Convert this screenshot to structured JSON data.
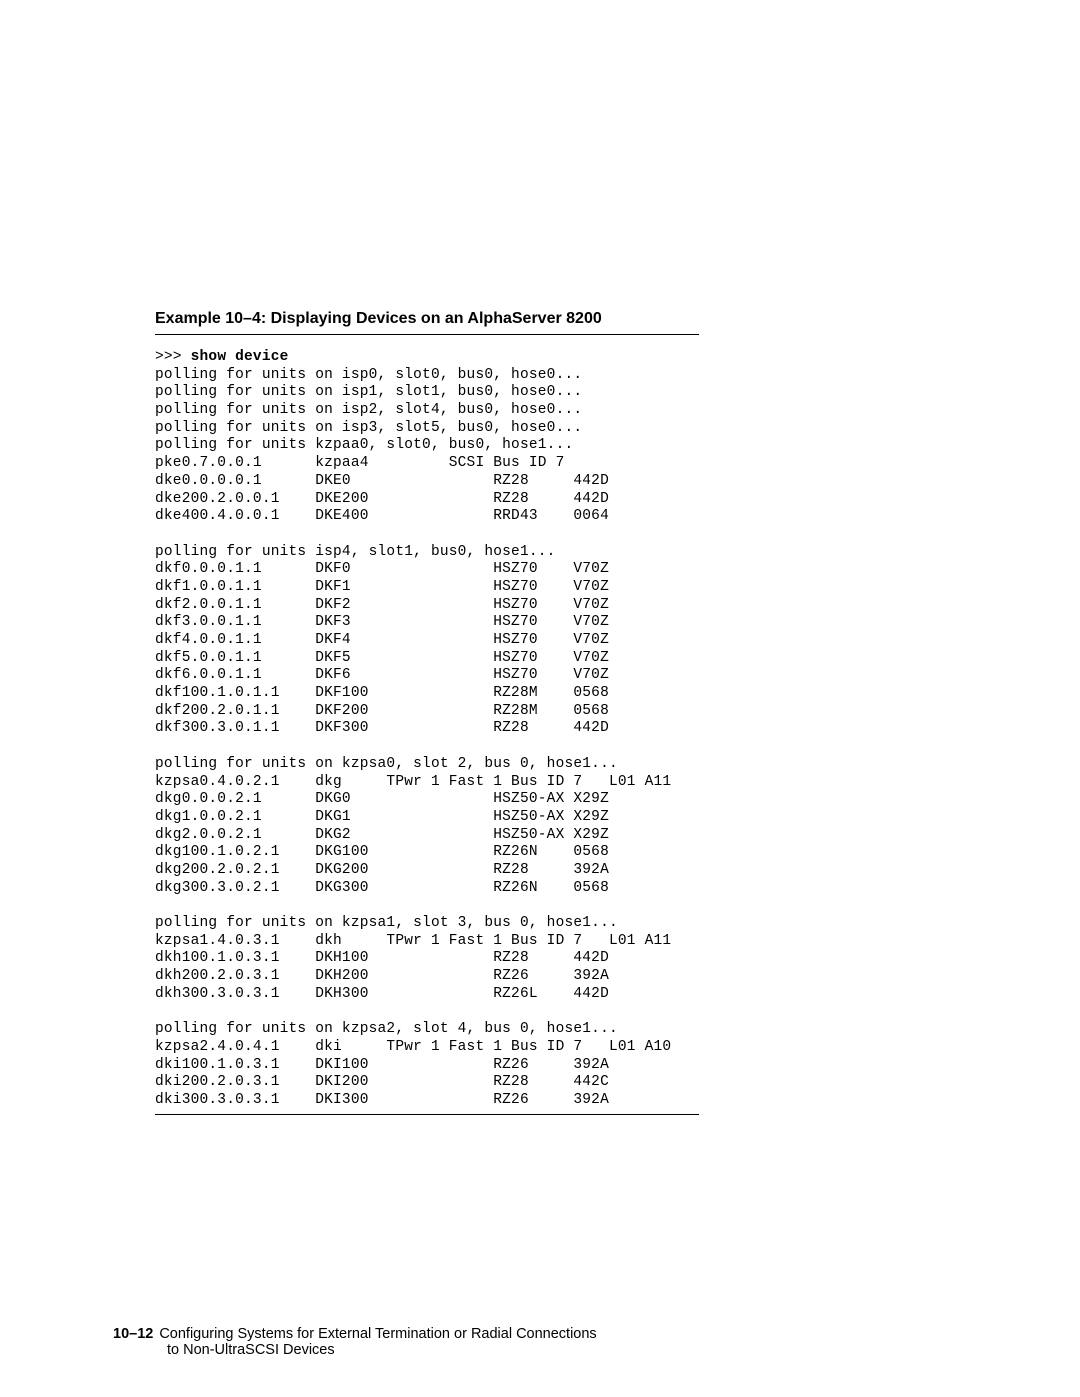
{
  "title": "Example 10–4: Displaying Devices on an AlphaServer 8200",
  "prompt": ">>> ",
  "command": "show device",
  "lines": [
    "polling for units on isp0, slot0, bus0, hose0...",
    "polling for units on isp1, slot1, bus0, hose0...",
    "polling for units on isp2, slot4, bus0, hose0...",
    "polling for units on isp3, slot5, bus0, hose0...",
    "polling for units kzpaa0, slot0, bus0, hose1...",
    "pke0.7.0.0.1      kzpaa4         SCSI Bus ID 7",
    "dke0.0.0.0.1      DKE0                RZ28     442D",
    "dke200.2.0.0.1    DKE200              RZ28     442D",
    "dke400.4.0.0.1    DKE400              RRD43    0064",
    "",
    "polling for units isp4, slot1, bus0, hose1...",
    "dkf0.0.0.1.1      DKF0                HSZ70    V70Z",
    "dkf1.0.0.1.1      DKF1                HSZ70    V70Z",
    "dkf2.0.0.1.1      DKF2                HSZ70    V70Z",
    "dkf3.0.0.1.1      DKF3                HSZ70    V70Z",
    "dkf4.0.0.1.1      DKF4                HSZ70    V70Z",
    "dkf5.0.0.1.1      DKF5                HSZ70    V70Z",
    "dkf6.0.0.1.1      DKF6                HSZ70    V70Z",
    "dkf100.1.0.1.1    DKF100              RZ28M    0568",
    "dkf200.2.0.1.1    DKF200              RZ28M    0568",
    "dkf300.3.0.1.1    DKF300              RZ28     442D",
    "",
    "polling for units on kzpsa0, slot 2, bus 0, hose1...",
    "kzpsa0.4.0.2.1    dkg     TPwr 1 Fast 1 Bus ID 7   L01 A11",
    "dkg0.0.0.2.1      DKG0                HSZ50-AX X29Z",
    "dkg1.0.0.2.1      DKG1                HSZ50-AX X29Z",
    "dkg2.0.0.2.1      DKG2                HSZ50-AX X29Z",
    "dkg100.1.0.2.1    DKG100              RZ26N    0568",
    "dkg200.2.0.2.1    DKG200              RZ28     392A",
    "dkg300.3.0.2.1    DKG300              RZ26N    0568",
    "",
    "polling for units on kzpsa1, slot 3, bus 0, hose1...",
    "kzpsa1.4.0.3.1    dkh     TPwr 1 Fast 1 Bus ID 7   L01 A11",
    "dkh100.1.0.3.1    DKH100              RZ28     442D",
    "dkh200.2.0.3.1    DKH200              RZ26     392A",
    "dkh300.3.0.3.1    DKH300              RZ26L    442D",
    "",
    "polling for units on kzpsa2, slot 4, bus 0, hose1...",
    "kzpsa2.4.0.4.1    dki     TPwr 1 Fast 1 Bus ID 7   L01 A10",
    "dki100.1.0.3.1    DKI100              RZ26     392A",
    "dki200.2.0.3.1    DKI200              RZ28     442C",
    "dki300.3.0.3.1    DKI300              RZ26     392A"
  ],
  "footer": {
    "pagenum": "10–12",
    "line1": "Configuring Systems for External Termination or Radial Connections",
    "line2": "to Non-UltraSCSI Devices"
  }
}
